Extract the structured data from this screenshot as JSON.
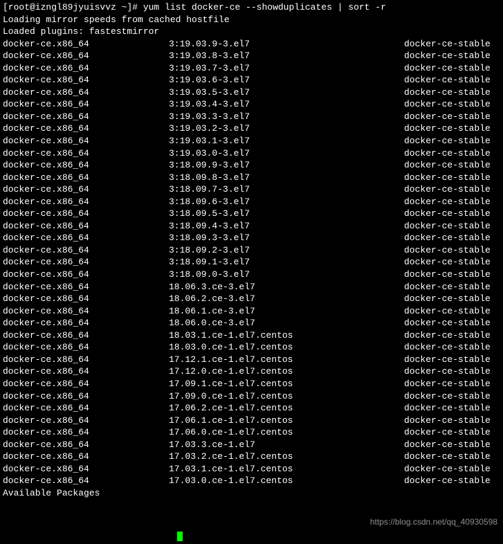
{
  "prompt": "[root@izngl89jyuisvvz ~]# yum list docker-ce --showduplicates | sort -r",
  "line1": "Loading mirror speeds from cached hostfile",
  "line2": "Loaded plugins: fastestmirror",
  "rows": [
    {
      "pkg": "docker-ce.x86_64",
      "ver": "3:19.03.9-3.el7",
      "repo": "docker-ce-stable"
    },
    {
      "pkg": "docker-ce.x86_64",
      "ver": "3:19.03.8-3.el7",
      "repo": "docker-ce-stable"
    },
    {
      "pkg": "docker-ce.x86_64",
      "ver": "3:19.03.7-3.el7",
      "repo": "docker-ce-stable"
    },
    {
      "pkg": "docker-ce.x86_64",
      "ver": "3:19.03.6-3.el7",
      "repo": "docker-ce-stable"
    },
    {
      "pkg": "docker-ce.x86_64",
      "ver": "3:19.03.5-3.el7",
      "repo": "docker-ce-stable"
    },
    {
      "pkg": "docker-ce.x86_64",
      "ver": "3:19.03.4-3.el7",
      "repo": "docker-ce-stable"
    },
    {
      "pkg": "docker-ce.x86_64",
      "ver": "3:19.03.3-3.el7",
      "repo": "docker-ce-stable"
    },
    {
      "pkg": "docker-ce.x86_64",
      "ver": "3:19.03.2-3.el7",
      "repo": "docker-ce-stable"
    },
    {
      "pkg": "docker-ce.x86_64",
      "ver": "3:19.03.1-3.el7",
      "repo": "docker-ce-stable"
    },
    {
      "pkg": "docker-ce.x86_64",
      "ver": "3:19.03.0-3.el7",
      "repo": "docker-ce-stable"
    },
    {
      "pkg": "docker-ce.x86_64",
      "ver": "3:18.09.9-3.el7",
      "repo": "docker-ce-stable"
    },
    {
      "pkg": "docker-ce.x86_64",
      "ver": "3:18.09.8-3.el7",
      "repo": "docker-ce-stable"
    },
    {
      "pkg": "docker-ce.x86_64",
      "ver": "3:18.09.7-3.el7",
      "repo": "docker-ce-stable"
    },
    {
      "pkg": "docker-ce.x86_64",
      "ver": "3:18.09.6-3.el7",
      "repo": "docker-ce-stable"
    },
    {
      "pkg": "docker-ce.x86_64",
      "ver": "3:18.09.5-3.el7",
      "repo": "docker-ce-stable"
    },
    {
      "pkg": "docker-ce.x86_64",
      "ver": "3:18.09.4-3.el7",
      "repo": "docker-ce-stable"
    },
    {
      "pkg": "docker-ce.x86_64",
      "ver": "3:18.09.3-3.el7",
      "repo": "docker-ce-stable"
    },
    {
      "pkg": "docker-ce.x86_64",
      "ver": "3:18.09.2-3.el7",
      "repo": "docker-ce-stable"
    },
    {
      "pkg": "docker-ce.x86_64",
      "ver": "3:18.09.1-3.el7",
      "repo": "docker-ce-stable"
    },
    {
      "pkg": "docker-ce.x86_64",
      "ver": "3:18.09.0-3.el7",
      "repo": "docker-ce-stable"
    },
    {
      "pkg": "docker-ce.x86_64",
      "ver": "18.06.3.ce-3.el7",
      "repo": "docker-ce-stable"
    },
    {
      "pkg": "docker-ce.x86_64",
      "ver": "18.06.2.ce-3.el7",
      "repo": "docker-ce-stable"
    },
    {
      "pkg": "docker-ce.x86_64",
      "ver": "18.06.1.ce-3.el7",
      "repo": "docker-ce-stable"
    },
    {
      "pkg": "docker-ce.x86_64",
      "ver": "18.06.0.ce-3.el7",
      "repo": "docker-ce-stable"
    },
    {
      "pkg": "docker-ce.x86_64",
      "ver": "18.03.1.ce-1.el7.centos",
      "repo": "docker-ce-stable"
    },
    {
      "pkg": "docker-ce.x86_64",
      "ver": "18.03.0.ce-1.el7.centos",
      "repo": "docker-ce-stable"
    },
    {
      "pkg": "docker-ce.x86_64",
      "ver": "17.12.1.ce-1.el7.centos",
      "repo": "docker-ce-stable"
    },
    {
      "pkg": "docker-ce.x86_64",
      "ver": "17.12.0.ce-1.el7.centos",
      "repo": "docker-ce-stable"
    },
    {
      "pkg": "docker-ce.x86_64",
      "ver": "17.09.1.ce-1.el7.centos",
      "repo": "docker-ce-stable"
    },
    {
      "pkg": "docker-ce.x86_64",
      "ver": "17.09.0.ce-1.el7.centos",
      "repo": "docker-ce-stable"
    },
    {
      "pkg": "docker-ce.x86_64",
      "ver": "17.06.2.ce-1.el7.centos",
      "repo": "docker-ce-stable"
    },
    {
      "pkg": "docker-ce.x86_64",
      "ver": "17.06.1.ce-1.el7.centos",
      "repo": "docker-ce-stable"
    },
    {
      "pkg": "docker-ce.x86_64",
      "ver": "17.06.0.ce-1.el7.centos",
      "repo": "docker-ce-stable"
    },
    {
      "pkg": "docker-ce.x86_64",
      "ver": "17.03.3.ce-1.el7",
      "repo": "docker-ce-stable"
    },
    {
      "pkg": "docker-ce.x86_64",
      "ver": "17.03.2.ce-1.el7.centos",
      "repo": "docker-ce-stable"
    },
    {
      "pkg": "docker-ce.x86_64",
      "ver": "17.03.1.ce-1.el7.centos",
      "repo": "docker-ce-stable"
    },
    {
      "pkg": "docker-ce.x86_64",
      "ver": "17.03.0.ce-1.el7.centos",
      "repo": "docker-ce-stable"
    }
  ],
  "footer": "Available Packages",
  "watermark": "https://blog.csdn.net/qq_40930598"
}
